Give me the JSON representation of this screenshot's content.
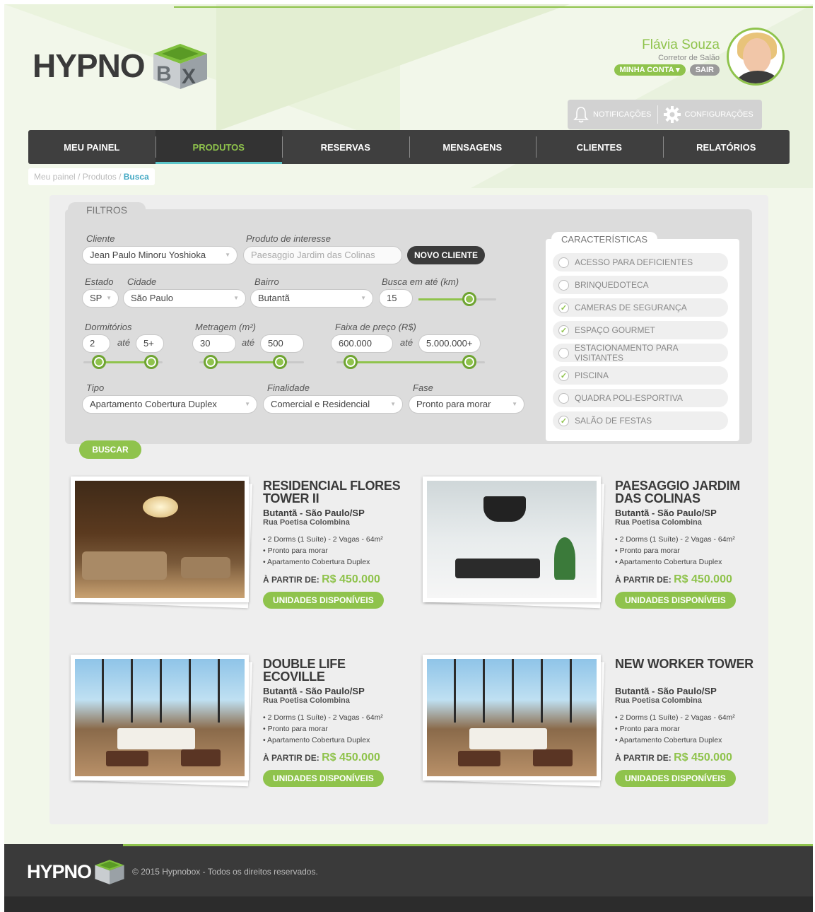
{
  "brand": {
    "logo_text": "HYPNOBOX"
  },
  "user": {
    "name": "Flávia Souza",
    "role": "Corretor de Salão",
    "account_button": "MINHA CONTA ▾",
    "logout_button": "SAIR"
  },
  "utility": {
    "notifications": "NOTIFICAÇÕES",
    "settings": "CONFIGURAÇÕES"
  },
  "nav": {
    "tabs": [
      "MEU PAINEL",
      "PRODUTOS",
      "RESERVAS",
      "MENSAGENS",
      "CLIENTES",
      "RELATÓRIOS"
    ],
    "active": "PRODUTOS"
  },
  "breadcrumb": {
    "path": "Meu painel / Produtos / ",
    "current": "Busca"
  },
  "filters": {
    "title": "FILTROS",
    "cliente_label": "Cliente",
    "cliente_value": "Jean Paulo Minoru Yoshioka",
    "produto_label": "Produto de interesse",
    "produto_placeholder": "Paesaggio Jardim das Colinas",
    "novo_cliente": "NOVO CLIENTE",
    "estado_label": "Estado",
    "estado_value": "SP",
    "cidade_label": "Cidade",
    "cidade_value": "São Paulo",
    "bairro_label": "Bairro",
    "bairro_value": "Butantã",
    "busca_label": "Busca em até (km)",
    "busca_value": "15",
    "dorm_label": "Dormitórios",
    "dorm_min": "2",
    "dorm_max": "5+",
    "metragem_label": "Metragem (m²)",
    "metragem_min": "30",
    "metragem_max": "500",
    "preco_label": "Faixa de preço (R$)",
    "preco_min": "600.000",
    "preco_max": "5.000.000+",
    "ate": "até",
    "tipo_label": "Tipo",
    "tipo_value": "Apartamento Cobertura Duplex",
    "finalidade_label": "Finalidade",
    "finalidade_value": "Comercial e Residencial",
    "fase_label": "Fase",
    "fase_value": "Pronto para morar",
    "buscar": "BUSCAR"
  },
  "caracteristicas": {
    "title": "CARACTERÍSTICAS",
    "items": [
      {
        "label": "ACESSO PARA DEFICIENTES",
        "checked": false
      },
      {
        "label": "BRINQUEDOTECA",
        "checked": false
      },
      {
        "label": "CAMERAS DE SEGURANÇA",
        "checked": true
      },
      {
        "label": "ESPAÇO GOURMET",
        "checked": true
      },
      {
        "label": "ESTACIONAMENTO PARA VISITANTES",
        "checked": false
      },
      {
        "label": "PISCINA",
        "checked": true
      },
      {
        "label": "QUADRA POLI-ESPORTIVA",
        "checked": false
      },
      {
        "label": "SALÃO DE FESTAS",
        "checked": true
      }
    ]
  },
  "results": [
    {
      "title": "RESIDENCIAL FLORES TOWER II",
      "location": "Butantã - São Paulo/SP",
      "address": "Rua Poetisa Colombina",
      "features": [
        "2 Dorms (1 Suíte) - 2 Vagas - 64m²",
        "Pronto para morar",
        "Apartamento Cobertura Duplex"
      ],
      "price_label": "À PARTIR DE:",
      "price": "R$ 450.000",
      "button": "UNIDADES DISPONÍVEIS"
    },
    {
      "title": "PAESAGGIO JARDIM DAS COLINAS",
      "location": "Butantã - São Paulo/SP",
      "address": "Rua Poetisa Colombina",
      "features": [
        "2 Dorms (1 Suíte) - 2 Vagas - 64m²",
        "Pronto para morar",
        "Apartamento Cobertura Duplex"
      ],
      "price_label": "À PARTIR DE:",
      "price": "R$ 450.000",
      "button": "UNIDADES DISPONÍVEIS"
    },
    {
      "title": "DOUBLE LIFE ECOVILLE",
      "location": "Butantã - São Paulo/SP",
      "address": "Rua Poetisa Colombina",
      "features": [
        "2 Dorms (1 Suíte) - 2 Vagas - 64m²",
        "Pronto para morar",
        "Apartamento Cobertura Duplex"
      ],
      "price_label": "À PARTIR DE:",
      "price": "R$ 450.000",
      "button": "UNIDADES DISPONÍVEIS"
    },
    {
      "title": "NEW WORKER TOWER",
      "location": "Butantã - São Paulo/SP",
      "address": "Rua Poetisa Colombina",
      "features": [
        "2 Dorms (1 Suíte) - 2 Vagas - 64m²",
        "Pronto para morar",
        "Apartamento Cobertura Duplex"
      ],
      "price_label": "À PARTIR DE:",
      "price": "R$ 450.000",
      "button": "UNIDADES DISPONÍVEIS"
    }
  ],
  "footer": {
    "copyright": "© 2015 Hypnobox - Todos os direitos reservados."
  },
  "colors": {
    "accent": "#8fc34c",
    "dark": "#3f3f3f",
    "active_underline": "#5cc6c9",
    "breadcrumb_current": "#45a9c4"
  }
}
